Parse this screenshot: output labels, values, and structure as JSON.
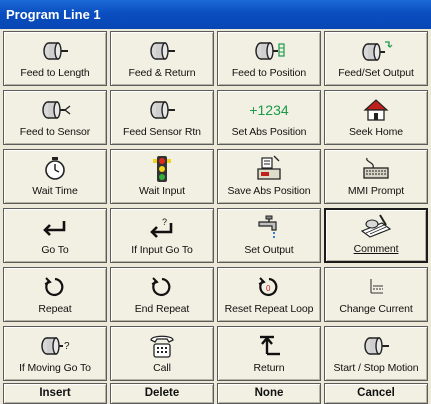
{
  "window": {
    "title": "Program Line 1"
  },
  "commands": [
    [
      {
        "label": "Feed to Length",
        "icon": "motor-icon"
      },
      {
        "label": "Feed & Return",
        "icon": "motor-icon"
      },
      {
        "label": "Feed to Position",
        "icon": "motor-position-icon"
      },
      {
        "label": "Feed/Set Output",
        "icon": "motor-output-icon"
      }
    ],
    [
      {
        "label": "Feed to Sensor",
        "icon": "motor-sensor-icon"
      },
      {
        "label": "Feed Sensor Rtn",
        "icon": "motor-icon"
      },
      {
        "label": "Set Abs Position",
        "icon": "abs-position-icon",
        "icon_text": "+1234"
      },
      {
        "label": "Seek Home",
        "icon": "home-icon"
      }
    ],
    [
      {
        "label": "Wait Time",
        "icon": "stopwatch-icon"
      },
      {
        "label": "Wait Input",
        "icon": "traffic-light-icon"
      },
      {
        "label": "Save Abs Position",
        "icon": "save-position-icon"
      },
      {
        "label": "MMI Prompt",
        "icon": "keyboard-icon"
      }
    ],
    [
      {
        "label": "Go To",
        "icon": "return-arrow-icon"
      },
      {
        "label": "If Input Go To",
        "icon": "conditional-arrow-icon"
      },
      {
        "label": "Set Output",
        "icon": "faucet-icon"
      },
      {
        "label": "Comment",
        "icon": "comment-icon"
      }
    ],
    [
      {
        "label": "Repeat",
        "icon": "loop-icon"
      },
      {
        "label": "End Repeat",
        "icon": "loop-icon"
      },
      {
        "label": "Reset Repeat Loop",
        "icon": "reset-loop-icon"
      },
      {
        "label": "Change Current",
        "icon": "current-icon"
      }
    ],
    [
      {
        "label": "If Moving Go To",
        "icon": "motor-question-icon"
      },
      {
        "label": "Call",
        "icon": "telephone-icon"
      },
      {
        "label": "Return",
        "icon": "return-icon"
      },
      {
        "label": "Start / Stop Motion",
        "icon": "motor-icon"
      }
    ]
  ],
  "selected": "Comment",
  "bottom_buttons": {
    "insert": "Insert",
    "delete": "Delete",
    "none": "None",
    "cancel": "Cancel"
  },
  "colors": {
    "titlebar": "#0a4ec0",
    "button_face": "#f2f0e2",
    "icon_green": "#1c9a4a",
    "icon_red": "#c0201c"
  }
}
